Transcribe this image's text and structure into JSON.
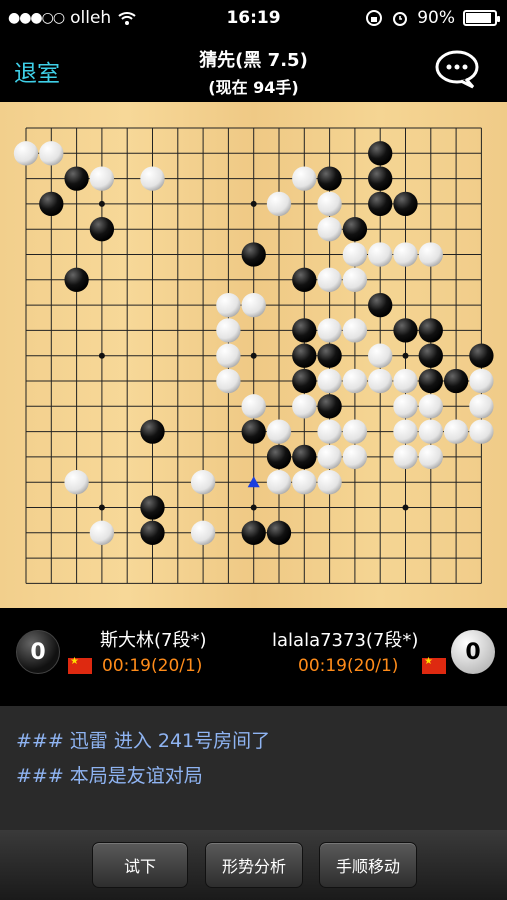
{
  "status_bar": {
    "carrier": "olleh",
    "signal": "●●●○○",
    "time": "16:19",
    "battery": "90%",
    "battery_level": 0.9
  },
  "nav": {
    "back_label": "退室",
    "title": "猜先(黑 7.5)",
    "subtitle": "(现在 94手)",
    "chat_icon": "chat-bubble-icon"
  },
  "board": {
    "size": 19,
    "star_points": [
      [
        3,
        3
      ],
      [
        3,
        9
      ],
      [
        3,
        15
      ],
      [
        9,
        3
      ],
      [
        9,
        9
      ],
      [
        9,
        15
      ],
      [
        15,
        3
      ],
      [
        15,
        9
      ],
      [
        15,
        15
      ]
    ],
    "black": [
      [
        2,
        2
      ],
      [
        3,
        2
      ],
      [
        3,
        4
      ],
      [
        1,
        3
      ],
      [
        2,
        6
      ],
      [
        9,
        5
      ],
      [
        9,
        7
      ],
      [
        9,
        12
      ],
      [
        8,
        9
      ],
      [
        11,
        6
      ],
      [
        12,
        2
      ],
      [
        12,
        4
      ],
      [
        14,
        1
      ],
      [
        14,
        2
      ],
      [
        14,
        3
      ],
      [
        13,
        4
      ],
      [
        11,
        8
      ],
      [
        11,
        9
      ],
      [
        11,
        10
      ],
      [
        12,
        9
      ],
      [
        12,
        11
      ],
      [
        15,
        3
      ],
      [
        14,
        7
      ],
      [
        15,
        8
      ],
      [
        14,
        9
      ],
      [
        15,
        10
      ],
      [
        15,
        12
      ],
      [
        15,
        13
      ],
      [
        16,
        8
      ],
      [
        16,
        9
      ],
      [
        16,
        10
      ],
      [
        17,
        10
      ],
      [
        18,
        9
      ],
      [
        17,
        12
      ],
      [
        16,
        13
      ],
      [
        18,
        12
      ],
      [
        13,
        8
      ],
      [
        12,
        13
      ],
      [
        11,
        13
      ],
      [
        10,
        13
      ],
      [
        11,
        14
      ],
      [
        10,
        16
      ],
      [
        9,
        16
      ],
      [
        5,
        12
      ],
      [
        5,
        15
      ],
      [
        5,
        16
      ],
      [
        3,
        16
      ],
      [
        1,
        1
      ]
    ],
    "white": [
      [
        0,
        1
      ],
      [
        1,
        1
      ],
      [
        3,
        2
      ],
      [
        5,
        2
      ],
      [
        11,
        2
      ],
      [
        10,
        3
      ],
      [
        12,
        3
      ],
      [
        12,
        4
      ],
      [
        13,
        5
      ],
      [
        14,
        5
      ],
      [
        15,
        5
      ],
      [
        16,
        5
      ],
      [
        12,
        6
      ],
      [
        13,
        6
      ],
      [
        8,
        7
      ],
      [
        9,
        7
      ],
      [
        8,
        8
      ],
      [
        12,
        8
      ],
      [
        13,
        8
      ],
      [
        8,
        9
      ],
      [
        14,
        9
      ],
      [
        12,
        10
      ],
      [
        15,
        10
      ],
      [
        14,
        10
      ],
      [
        13,
        10
      ],
      [
        8,
        10
      ],
      [
        18,
        10
      ],
      [
        9,
        11
      ],
      [
        11,
        11
      ],
      [
        15,
        11
      ],
      [
        16,
        11
      ],
      [
        18,
        11
      ],
      [
        10,
        12
      ],
      [
        12,
        12
      ],
      [
        13,
        12
      ],
      [
        15,
        12
      ],
      [
        16,
        12
      ],
      [
        17,
        12
      ],
      [
        18,
        12
      ],
      [
        12,
        13
      ],
      [
        13,
        13
      ],
      [
        15,
        13
      ],
      [
        16,
        13
      ],
      [
        2,
        14
      ],
      [
        7,
        14
      ],
      [
        10,
        14
      ],
      [
        11,
        14
      ],
      [
        12,
        14
      ],
      [
        3,
        16
      ],
      [
        7,
        16
      ]
    ],
    "last_move": [
      9,
      14
    ]
  },
  "players": {
    "black": {
      "name": "斯大林(7段*)",
      "time": "00:19(20/1)",
      "captures": "0"
    },
    "white": {
      "name": "lalala7373(7段*)",
      "time": "00:19(20/1)",
      "captures": "0"
    }
  },
  "chat": {
    "messages": [
      "### 迅雷 进入 241号房间了",
      "### 本局是友谊对局"
    ]
  },
  "toolbar": {
    "try_label": "试下",
    "analysis_label": "形势分析",
    "move_label": "手顺移动"
  }
}
